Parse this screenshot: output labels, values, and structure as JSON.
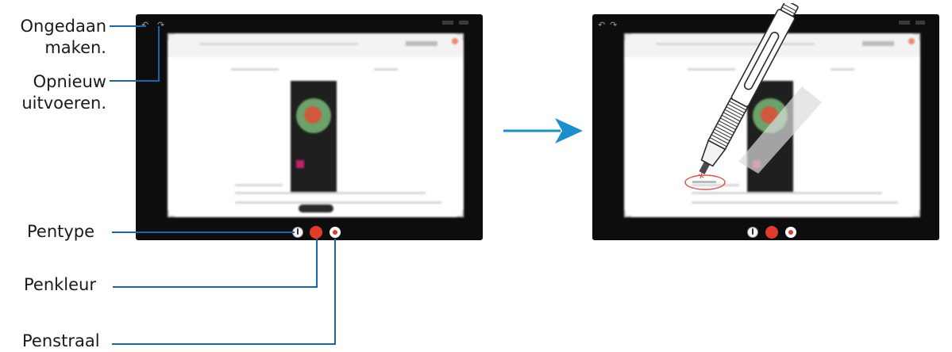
{
  "callouts": {
    "undo": "Ongedaan\nmaken.",
    "redo": "Opnieuw\nuitvoeren.",
    "pen_type": "Pentype",
    "pen_color": "Penkleur",
    "pen_radius": "Penstraal"
  },
  "colors": {
    "callout_line": "#1766ad",
    "arrow": "#1a8fd0",
    "pen_color_red": "#e23b2c",
    "tablet_frame": "#0d0d0d"
  },
  "icons": [
    "undo-icon",
    "redo-icon",
    "pen-type-icon",
    "pen-color-icon",
    "pen-radius-icon",
    "arrow-right-icon",
    "s-pen-stylus"
  ]
}
